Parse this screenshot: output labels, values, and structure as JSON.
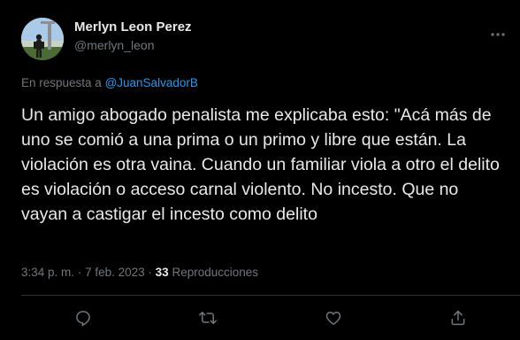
{
  "author": {
    "display_name": "Merlyn Leon Perez",
    "handle": "@merlyn_leon",
    "avatar": "profile-photo"
  },
  "reply": {
    "prefix": "En respuesta a",
    "mention": "@JuanSalvadorB"
  },
  "tweet": {
    "text": "Un amigo abogado penalista me explicaba esto: \"Acá más de uno se comió a una prima o un primo y libre que están. La violación es otra vaina. Cuando un familiar viola a otro el delito es violación o acceso carnal violento. No incesto. Que no vayan a castigar el incesto como delito"
  },
  "meta": {
    "time": "3:34 p. m.",
    "separator": "·",
    "date": "7 feb. 2023",
    "views_count": "33",
    "views_label": "Reproducciones"
  },
  "actions": [
    {
      "icon": "reply-icon"
    },
    {
      "icon": "retweet-icon"
    },
    {
      "icon": "like-icon"
    },
    {
      "icon": "share-icon"
    }
  ],
  "colors": {
    "background": "#000000",
    "text": "#e7e9ea",
    "secondary": "#71767b",
    "accent": "#1d9bf0",
    "divider": "#2f3336"
  }
}
